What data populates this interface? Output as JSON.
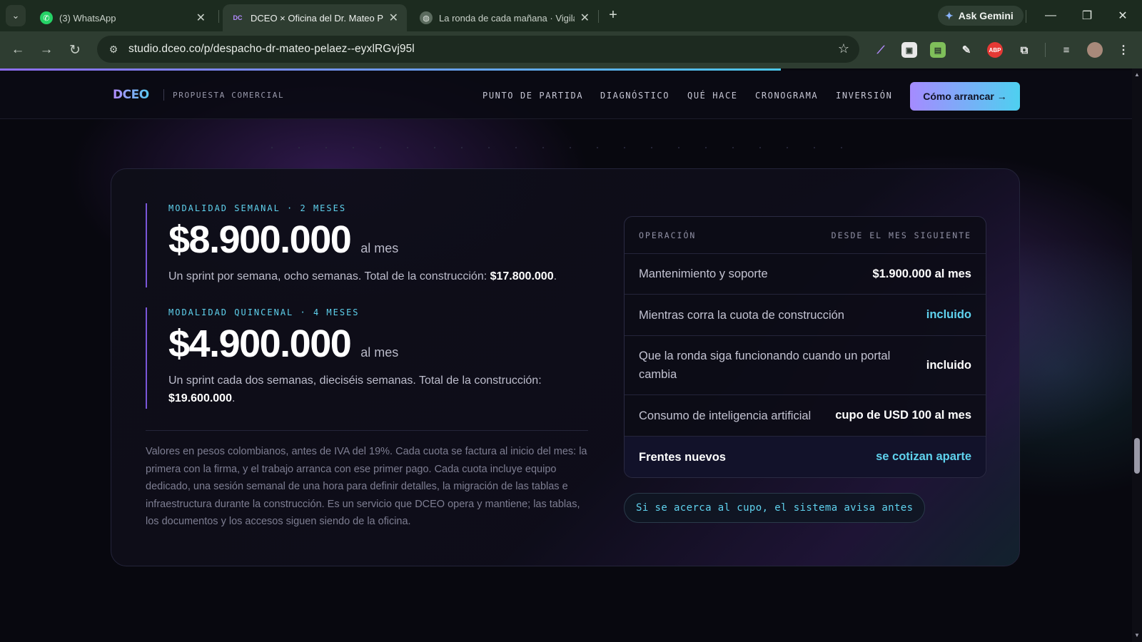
{
  "browser": {
    "tabs": [
      {
        "title": "(3) WhatsApp",
        "icon": "whatsapp-icon"
      },
      {
        "title": "DCEO × Oficina del Dr. Mateo Pelá",
        "icon": "dceo-icon"
      },
      {
        "title": "La ronda de cada mañana · Vigilan",
        "icon": "globe-icon"
      }
    ],
    "gemini_label": "Ask Gemini",
    "url": "studio.dceo.co/p/despacho-dr-mateo-pelaez--eyxlRGvj95l",
    "extensions": [
      {
        "name": "feather-extension-icon",
        "color": "#b48bff"
      },
      {
        "name": "briefcase-extension-icon",
        "color": "#e8e8e8"
      },
      {
        "name": "ticket-extension-icon",
        "color": "#7fbf5a"
      },
      {
        "name": "eyedropper-extension-icon",
        "color": "#e8e8e8"
      },
      {
        "name": "adblock-extension-icon",
        "label": "ABP",
        "color": "#e53935"
      },
      {
        "name": "puzzle-extension-icon",
        "color": "#e8e8e8"
      }
    ]
  },
  "site": {
    "logo": "DCEO",
    "kicker": "PROPUESTA COMERCIAL",
    "nav": [
      "PUNTO DE PARTIDA",
      "DIAGNÓSTICO",
      "QUÉ HACE",
      "CRONOGRAMA",
      "INVERSIÓN"
    ],
    "cta": "Cómo arrancar →",
    "scroll_progress": 0.69
  },
  "pricing": {
    "plans": [
      {
        "label": "MODALIDAD SEMANAL · 2 MESES",
        "price": "$8.900.000",
        "period": "al mes",
        "desc_pre": "Un sprint por semana, ocho semanas. Total de la construcción: ",
        "desc_total": "$17.800.000",
        "desc_post": "."
      },
      {
        "label": "MODALIDAD QUINCENAL · 4 MESES",
        "price": "$4.900.000",
        "period": "al mes",
        "desc_pre": "Un sprint cada dos semanas, dieciséis semanas. Total de la construcción: ",
        "desc_total": "$19.600.000",
        "desc_post": "."
      }
    ],
    "footnote": "Valores en pesos colombianos, antes de IVA del 19%. Cada cuota se factura al inicio del mes: la primera con la firma, y el trabajo arranca con ese primer pago. Cada cuota incluye equipo dedicado, una sesión semanal de una hora para definir detalles, la migración de las tablas e infraestructura durante la construcción. Es un servicio que DCEO opera y mantiene; las tablas, los documentos y los accesos siguen siendo de la oficina."
  },
  "operations": {
    "header_left": "OPERACIÓN",
    "header_right": "DESDE EL MES SIGUIENTE",
    "rows": [
      {
        "label": "Mantenimiento y soporte",
        "value": "$1.900.000 al mes"
      },
      {
        "label": "Mientras corra la cuota de construcción",
        "value": "incluido"
      },
      {
        "label": "Que la ronda siga funcionando cuando un portal cambia",
        "value": "incluido"
      },
      {
        "label": "Consumo de inteligencia artificial",
        "value": "cupo de USD 100 al mes"
      },
      {
        "label": "Frentes nuevos",
        "value": "se cotizan aparte"
      }
    ],
    "notice": "Si se acerca al cupo, el sistema avisa antes"
  },
  "colors": {
    "accent_cyan": "#5fd2ee",
    "accent_violet": "#7a56d8",
    "background": "#08080f"
  }
}
